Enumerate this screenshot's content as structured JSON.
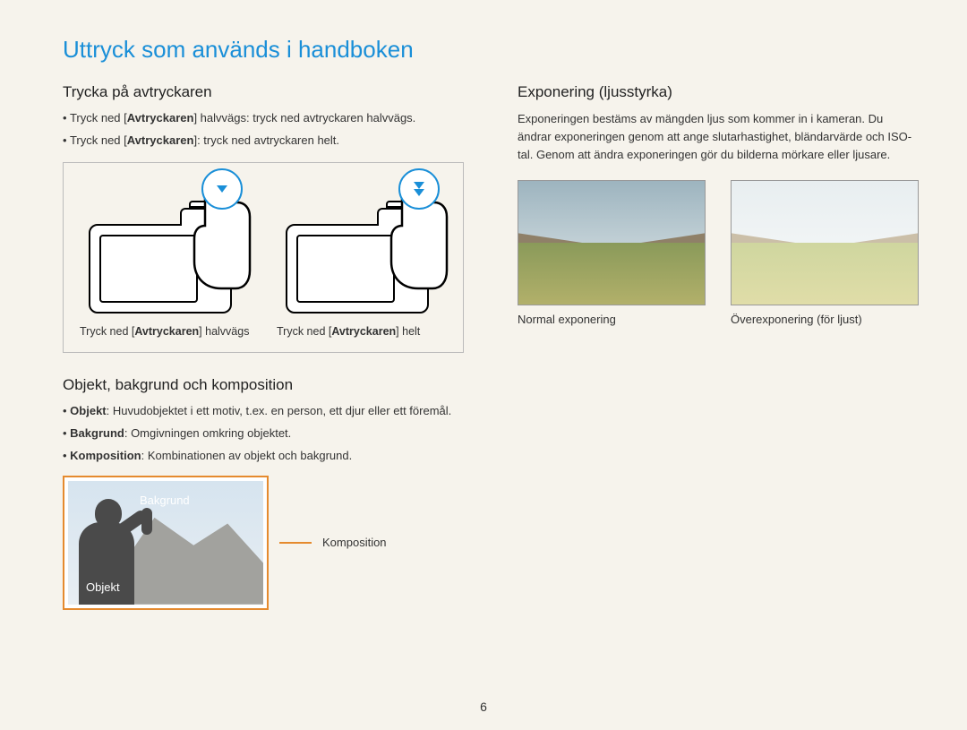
{
  "title": "Uttryck som används i handboken",
  "left": {
    "section1": {
      "heading": "Trycka på avtryckaren",
      "bullets": [
        {
          "pre": "Tryck ned [",
          "bold": "Avtryckaren",
          "post": "] halvvägs: tryck ned avtryckaren halvvägs."
        },
        {
          "pre": "Tryck ned [",
          "bold": "Avtryckaren",
          "post": "]: tryck ned avtryckaren helt."
        }
      ],
      "captions": [
        {
          "pre": "Tryck ned [",
          "bold": "Avtryckaren",
          "post": "] halvvägs"
        },
        {
          "pre": "Tryck ned [",
          "bold": "Avtryckaren",
          "post": "] helt"
        }
      ]
    },
    "section2": {
      "heading": "Objekt, bakgrund och komposition",
      "bullets": [
        {
          "bold": "Objekt",
          "post": ": Huvudobjektet i ett motiv, t.ex. en person, ett djur eller ett föremål."
        },
        {
          "bold": "Bakgrund",
          "post": ": Omgivningen omkring objektet."
        },
        {
          "bold": "Komposition",
          "post": ": Kombinationen av objekt och bakgrund."
        }
      ],
      "labels": {
        "bakgrund": "Bakgrund",
        "objekt": "Objekt",
        "komposition": "Komposition"
      }
    }
  },
  "right": {
    "heading": "Exponering (ljusstyrka)",
    "text": "Exponeringen bestäms av mängden ljus som kommer in i kameran. Du ändrar exponeringen genom att ange slutarhastighet, bländarvärde och ISO-tal. Genom att ändra exponeringen gör du bilderna mörkare eller ljusare.",
    "captions": {
      "normal": "Normal exponering",
      "over": "Överexponering (för ljust)"
    }
  },
  "page_number": "6"
}
